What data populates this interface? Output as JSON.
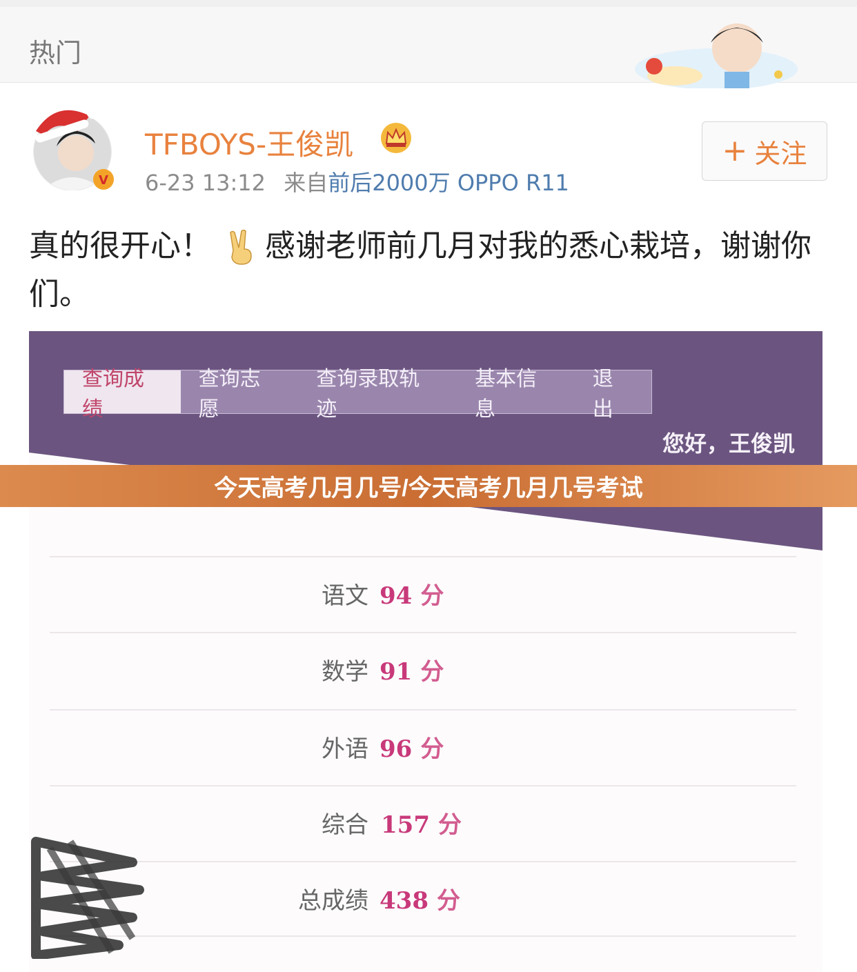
{
  "header": {
    "title": "热门"
  },
  "post": {
    "username": "TFBOYS-王俊凯",
    "time": "6-23 13:12",
    "source_prefix": "来自",
    "device": "前后2000万 OPPO R11",
    "follow_label": "关注",
    "follow_icon": "plus-icon",
    "text_before_emoji": "真的很开心！",
    "emoji": "victory-hand-emoji",
    "text_after_emoji": "感谢老师前几月对我的悉心栽培，谢谢你们。"
  },
  "photo": {
    "tabs": [
      {
        "label": "查询成绩",
        "active": true
      },
      {
        "label": "查询志愿",
        "active": false
      },
      {
        "label": "查询录取轨迹",
        "active": false
      },
      {
        "label": "基本信息",
        "active": false
      },
      {
        "label": "退出",
        "active": false
      }
    ],
    "greeting": "您好，王俊凯",
    "scores": [
      {
        "subject": "语文",
        "score": "94",
        "unit": "分"
      },
      {
        "subject": "数学",
        "score": "91",
        "unit": "分"
      },
      {
        "subject": "外语",
        "score": "96",
        "unit": "分"
      },
      {
        "subject": "综合",
        "score": "157",
        "unit": "分"
      },
      {
        "subject": "总成绩",
        "score": "438",
        "unit": "分"
      }
    ]
  },
  "overlay": {
    "caption": "今天高考几月几号/今天高考几月几号考试"
  },
  "colors": {
    "accent": "#e8823e",
    "link": "#4f7cae",
    "purple": "#6b5580",
    "score": "#c8397a"
  }
}
